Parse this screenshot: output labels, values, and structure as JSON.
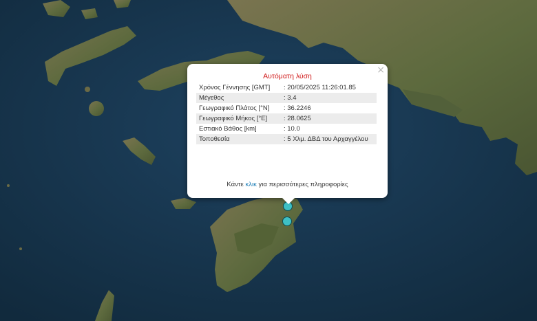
{
  "popup": {
    "title": "Αυτόματη λύση",
    "close_glyph": "×",
    "rows": [
      {
        "label": "Χρόνος Γέννησης [GMT]",
        "value": ": 20/05/2025 11:26:01.85"
      },
      {
        "label": "Μέγεθος",
        "value": ": 3.4"
      },
      {
        "label": "Γεωγραφικό Πλάτος [°N]",
        "value": ": 36.2246"
      },
      {
        "label": "Γεωγραφικό Μήκος [°E]",
        "value": ": 28.0625"
      },
      {
        "label": "Εστιακό Βάθος [km]",
        "value": ": 10.0"
      },
      {
        "label": "Τοποθεσία",
        "value": ": 5 Χλμ. ΔΒΔ του Αρχαγγέλου"
      }
    ],
    "more_before": "Κάντε ",
    "more_link": "κλικ",
    "more_after": " για περισσότερες πληροφορίες"
  },
  "markers": [
    {
      "name": "earthquake-marker-1",
      "color": "#3ec0c5"
    },
    {
      "name": "earthquake-marker-2",
      "color": "#3ec0c5"
    }
  ],
  "colors": {
    "sea": "#17344a",
    "land": "#6b6a45",
    "popup_title": "#d01818",
    "link": "#1f7fb8"
  }
}
